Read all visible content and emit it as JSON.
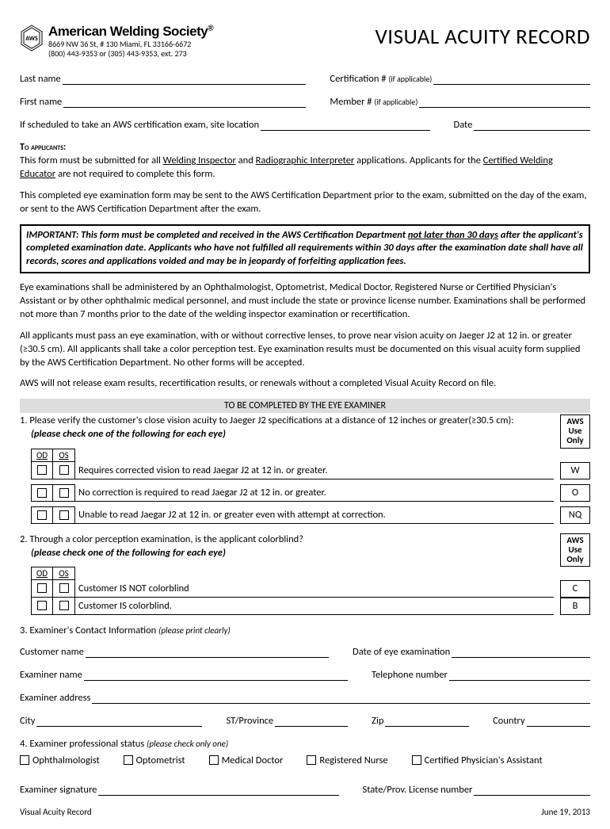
{
  "header": {
    "org_name": "American Welding Society",
    "reg": "®",
    "addr1": "8669 NW 36 St, # 130 Miami, FL 33166-6672",
    "addr2": "(800) 443-9353 or (305) 443-9353, ext. 273",
    "title": "VISUAL ACUITY RECORD"
  },
  "fields": {
    "last_name": "Last name",
    "cert_num": "Certification # ",
    "cert_sub": "(if applicable)",
    "first_name": "First name",
    "member_num": "Member # ",
    "member_sub": "(if applicable)",
    "site_loc": "If scheduled to take an AWS certification exam, site location",
    "date": "Date"
  },
  "applicants": {
    "heading": "To applicants:",
    "p1a": "This form must be submitted for all ",
    "p1b": "Welding Inspector",
    "p1c": " and ",
    "p1d": "Radiographic Interpreter",
    "p1e": " applications. Applicants for the ",
    "p1f": "Certified Welding Educator",
    "p1g": " are not required to complete this form.",
    "p2": "This completed eye examination form may be sent to the AWS Certification Department prior to the exam, submitted on the day of the exam, or sent to the AWS Certification Department after the exam."
  },
  "important": {
    "a": "IMPORTANT: This form must be completed and received in the AWS Certification Department ",
    "b": "not later than 30 days",
    "c": " after the applicant's completed examination date.  Applicants who have not fulfilled all requirements within 30 days after the examination date shall have all records, scores and applications voided and may be in jeopardy of forfeiting application fees."
  },
  "body": {
    "p3": "Eye examinations shall be administered by an Ophthalmologist, Optometrist, Medical Doctor, Registered Nurse or Certified Physician's Assistant or by other ophthalmic medical personnel, and must include the state or province license number.  Examinations shall be performed not more than 7 months prior to the date of the welding inspector examination or recertification.",
    "p4": "All applicants must pass an eye examination, with or without corrective lenses, to prove near vision acuity on Jaeger J2 at 12 in. or greater (≥30.5 cm). All applicants shall take a color perception test. Eye examination results must be documented on this visual acuity form supplied by the AWS Certification Department. No other forms will be accepted.",
    "p5": "AWS will not release exam results, recertification results, or renewals without a completed Visual Acuity Record on file."
  },
  "examiner": {
    "header": "TO BE COMPLETED BY THE EYE EXAMINER",
    "q1": "1. Please verify the customer's close vision acuity to Jaeger J2 specifications at a distance of 12 inches or greater(≥30.5 cm):",
    "instr": "(please check one of the following for each eye)",
    "aws_use": "AWS Use Only",
    "od": "OD",
    "os": "OS",
    "opt1": "Requires corrected vision to read Jaegar J2 at 12 in. or greater.",
    "code1": "W",
    "opt2": "No correction is required to read Jaegar J2 at 12 in. or greater.",
    "code2": "O",
    "opt3": "Unable to read Jaegar J2 at 12 in. or greater even with attempt at correction.",
    "code3": "NQ",
    "q2": "2. Through a color perception examination, is the applicant colorblind?",
    "opt4": "Customer IS NOT colorblind",
    "code4": "C",
    "opt5": "Customer IS colorblind.",
    "code5": "B"
  },
  "contact": {
    "title": "3. Examiner's Contact Information ",
    "title_sub": "(please print clearly)",
    "cust_name": "Customer name",
    "exam_date": "Date of eye examination",
    "exam_name": "Examiner name",
    "phone": "Telephone number",
    "exam_addr": "Examiner address",
    "city": "City",
    "st": "ST/Province",
    "zip": "Zip",
    "country": "Country"
  },
  "status": {
    "title": "4. Examiner professional status ",
    "title_sub": "(please check only one)",
    "s1": "Ophthalmologist",
    "s2": "Optometrist",
    "s3": "Medical Doctor",
    "s4": "Registered Nurse",
    "s5": "Certified Physician's Assistant"
  },
  "sig": {
    "sig": "Examiner signature",
    "lic": "State/Prov. License number"
  },
  "footer": {
    "left": "Visual Acuity Record",
    "right": "June 19, 2013"
  }
}
